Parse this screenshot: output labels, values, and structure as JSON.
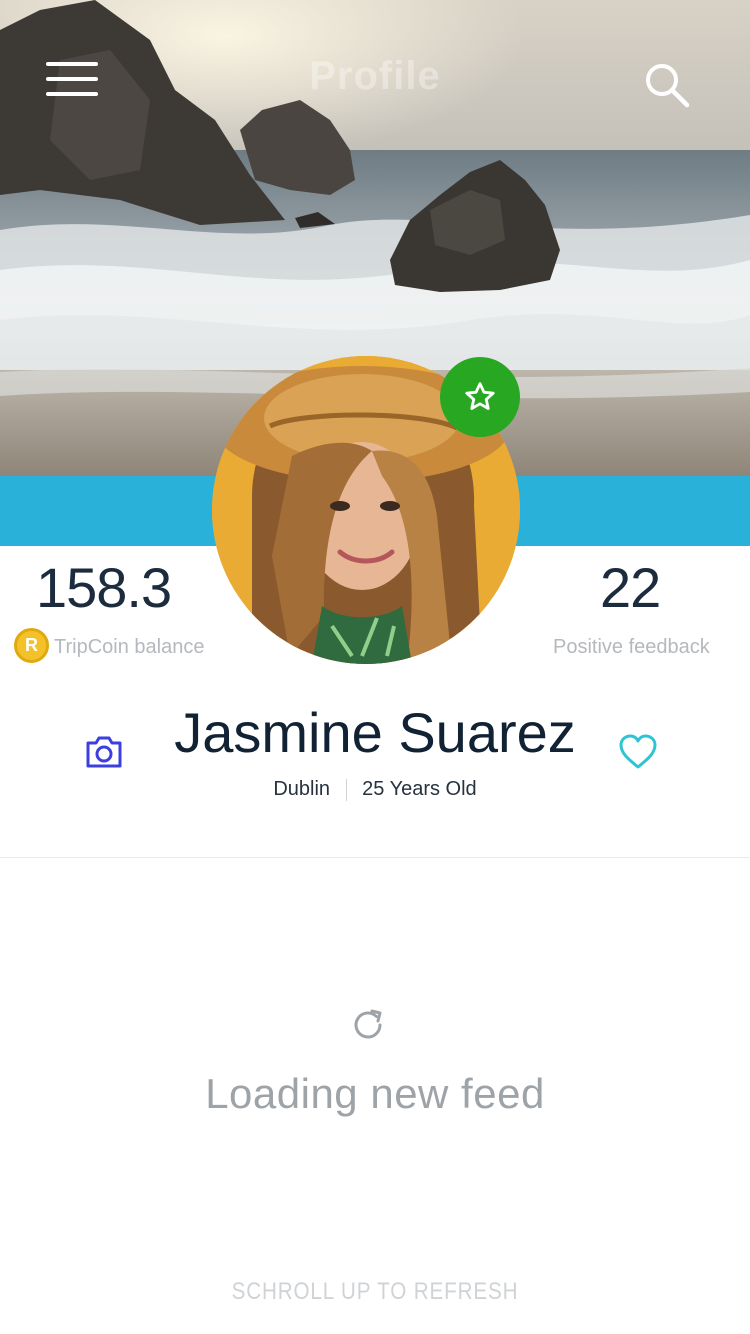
{
  "header": {
    "title": "Profile",
    "menu_icon": "hamburger-menu-icon",
    "search_icon": "search-icon"
  },
  "hero": {
    "description_icon": "beach-cover-photo"
  },
  "profile": {
    "badge_icon": "star-icon",
    "badge_color": "#28a722",
    "band_color": "#29b1d9",
    "name": "Jasmine Suarez",
    "city": "Dublin",
    "age": "25 Years Old"
  },
  "stats": {
    "balance_value": "158.3",
    "balance_label": "TripCoin balance",
    "coin_symbol": "R",
    "feedback_value": "22",
    "feedback_label": "Positive feedback"
  },
  "actions": {
    "camera_icon": "camera-icon",
    "camera_color": "#3c3fe0",
    "heart_icon": "heart-icon",
    "heart_color": "#2fc4d4"
  },
  "feed": {
    "loading_icon": "refresh-icon",
    "loading_text": "Loading new feed",
    "hint_text": "SCHROLL UP TO REFRESH"
  }
}
